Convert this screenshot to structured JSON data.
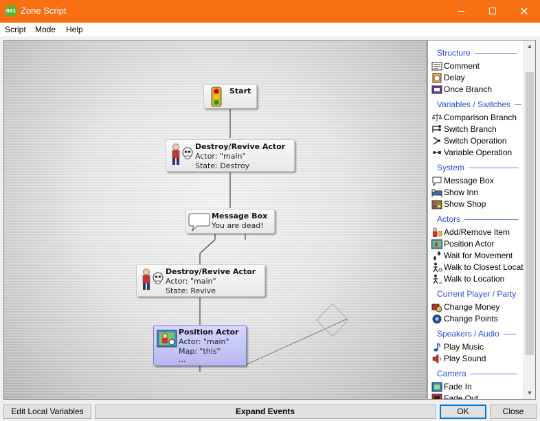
{
  "window": {
    "title": "Zone Script",
    "app_icon_text": "001",
    "close_glyph": "✕"
  },
  "menu": [
    "Script",
    "Mode",
    "Help"
  ],
  "nodes": {
    "start": {
      "title": "Start"
    },
    "destroy1": {
      "title": "Destroy/Revive Actor",
      "lines": [
        "Actor: \"main\"",
        "State: Destroy"
      ]
    },
    "message": {
      "title": "Message Box",
      "lines": [
        "You are dead!"
      ]
    },
    "destroy2": {
      "title": "Destroy/Revive Actor",
      "lines": [
        "Actor: \"main\"",
        "State: Revive"
      ]
    },
    "position": {
      "title": "Position Actor",
      "lines": [
        "Actor: \"main\"",
        "Map: \"this\"",
        "..."
      ]
    }
  },
  "palette": {
    "categories": [
      {
        "name": "Structure",
        "items": [
          {
            "label": "Comment",
            "icon": "comment-icon"
          },
          {
            "label": "Delay",
            "icon": "delay-icon"
          },
          {
            "label": "Once Branch",
            "icon": "once-branch-icon"
          }
        ]
      },
      {
        "name": "Variables / Switches",
        "items": [
          {
            "label": "Comparison Branch",
            "icon": "scales-icon"
          },
          {
            "label": "Switch Branch",
            "icon": "switch-branch-icon"
          },
          {
            "label": "Switch Operation",
            "icon": "switch-operation-icon"
          },
          {
            "label": "Variable Operation",
            "icon": "variable-operation-icon"
          }
        ]
      },
      {
        "name": "System",
        "items": [
          {
            "label": "Message Box",
            "icon": "speech-bubble-icon"
          },
          {
            "label": "Show Inn",
            "icon": "inn-icon"
          },
          {
            "label": "Show Shop",
            "icon": "shop-icon"
          }
        ]
      },
      {
        "name": "Actors",
        "items": [
          {
            "label": "Add/Remove Item",
            "icon": "add-item-icon"
          },
          {
            "label": "Position Actor",
            "icon": "position-actor-icon"
          },
          {
            "label": "Wait for Movement",
            "icon": "footsteps-icon"
          },
          {
            "label": "Walk to Closest Location",
            "icon": "walk-closest-icon"
          },
          {
            "label": "Walk to Location",
            "icon": "walk-icon"
          }
        ]
      },
      {
        "name": "Current Player / Party",
        "items": [
          {
            "label": "Change Money",
            "icon": "money-icon"
          },
          {
            "label": "Change Points",
            "icon": "points-icon"
          }
        ]
      },
      {
        "name": "Speakers / Audio",
        "items": [
          {
            "label": "Play Music",
            "icon": "music-note-icon"
          },
          {
            "label": "Play Sound",
            "icon": "speaker-icon"
          }
        ]
      },
      {
        "name": "Camera",
        "items": [
          {
            "label": "Fade In",
            "icon": "fade-in-icon"
          },
          {
            "label": "Fade Out",
            "icon": "fade-out-icon"
          }
        ]
      }
    ]
  },
  "buttons": {
    "edit_local": "Edit Local Variables",
    "expand": "Expand Events",
    "ok": "OK",
    "close": "Close"
  }
}
